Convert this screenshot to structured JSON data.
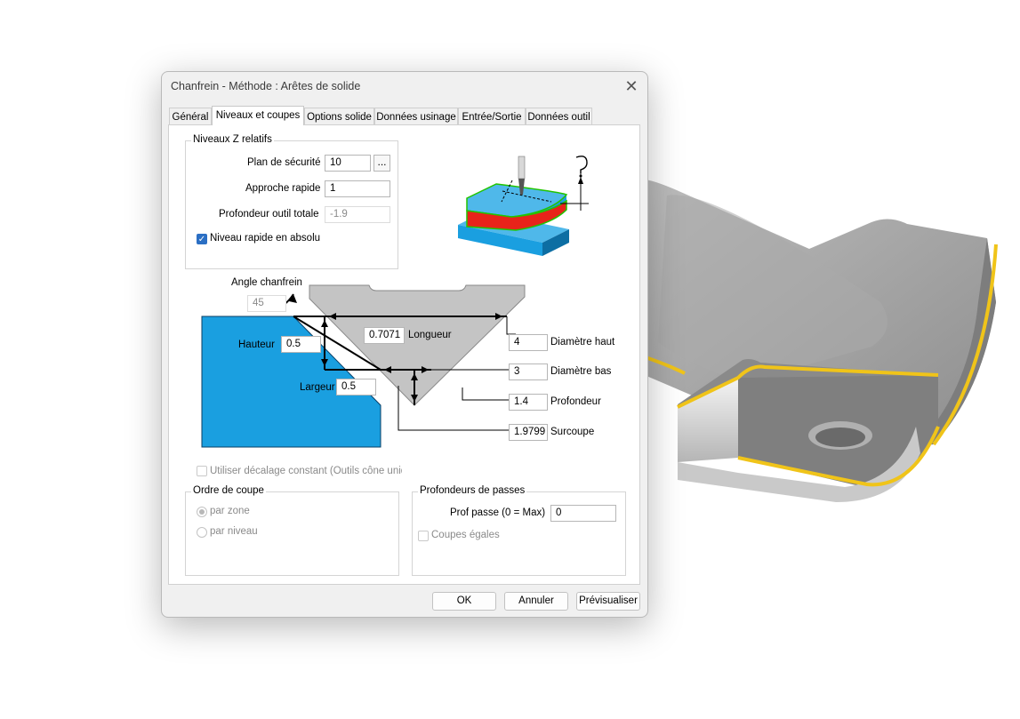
{
  "dialog": {
    "title": "Chanfrein - Méthode : Arêtes de solide",
    "close_glyph": "✕"
  },
  "tabs": [
    {
      "label": "Général"
    },
    {
      "label": "Niveaux et coupes"
    },
    {
      "label": "Options solide"
    },
    {
      "label": "Données usinage"
    },
    {
      "label": "Entrée/Sortie"
    },
    {
      "label": "Données outil"
    }
  ],
  "levels": {
    "group_label": "Niveaux Z relatifs",
    "safety_label": "Plan de sécurité",
    "safety_value": "10",
    "browse_label": "...",
    "rapid_label": "Approche rapide",
    "rapid_value": "1",
    "depth_label": "Profondeur outil totale",
    "depth_value": "-1.9",
    "absolute_label": "Niveau rapide en absolu",
    "absolute_checked": true
  },
  "diagram": {
    "angle_label": "Angle chanfrein",
    "angle_value": "45",
    "height_label": "Hauteur",
    "height_value": "0.5",
    "width_label": "Largeur",
    "width_value": "0.5",
    "length_value": "0.7071",
    "length_label": "Longueur",
    "top_diam_value": "4",
    "top_diam_label": "Diamètre haut",
    "bottom_diam_value": "3",
    "bottom_diam_label": "Diamètre bas",
    "depth_value": "1.4",
    "depth_label": "Profondeur",
    "overcut_value": "1.9799",
    "overcut_label": "Surcoupe",
    "stock_color": "#1a9fe0",
    "tool_color": "#c4c4c4"
  },
  "offset": {
    "label": "Utiliser décalage constant (Outils cône unique)",
    "checked": false
  },
  "cut_order": {
    "group_label": "Ordre de coupe",
    "options": [
      {
        "label": "par zone",
        "selected": true
      },
      {
        "label": "par niveau",
        "selected": false
      }
    ]
  },
  "passes": {
    "group_label": "Profondeurs de passes",
    "step_label": "Prof passe (0 = Max)",
    "step_value": "0",
    "equal_label": "Coupes égales",
    "equal_checked": false
  },
  "buttons": {
    "ok": "OK",
    "cancel": "Annuler",
    "preview": "Prévisualiser"
  },
  "colors": {
    "accent": "#2b6fc4",
    "edge_highlight": "#f0c419",
    "part_red": "#e8231a",
    "part_green": "#22c400"
  },
  "icons": {
    "help": "help-question-icon",
    "tool_illustration": "chamfer-tool-illustration",
    "background": "machined-part-render"
  }
}
